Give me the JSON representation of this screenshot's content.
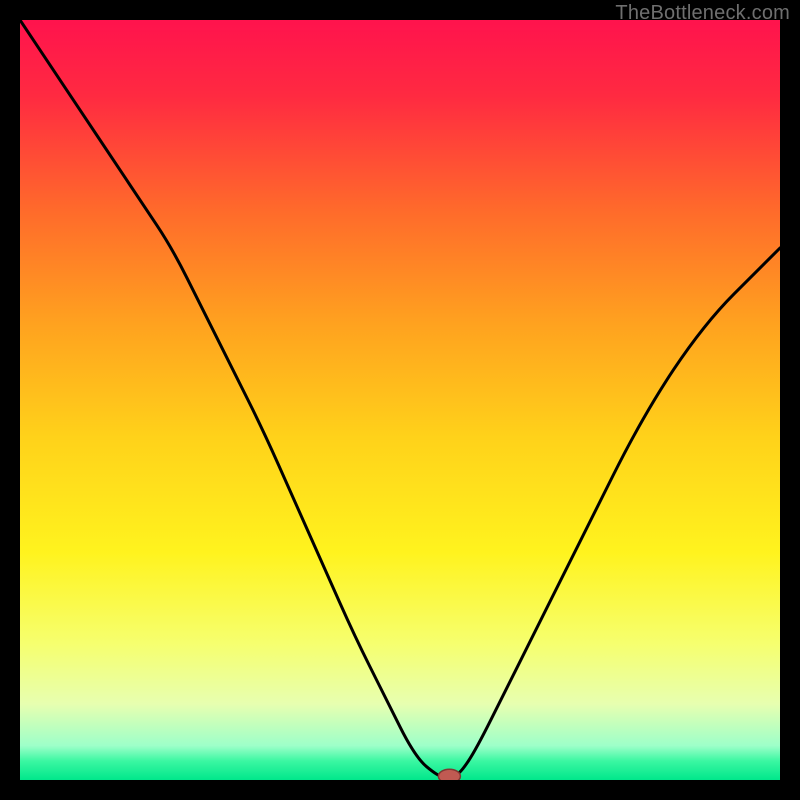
{
  "attribution": "TheBottleneck.com",
  "colors": {
    "frame": "#000000",
    "gradient_stops": [
      {
        "offset": 0.0,
        "color": "#ff134d"
      },
      {
        "offset": 0.1,
        "color": "#ff2a41"
      },
      {
        "offset": 0.25,
        "color": "#ff6a2b"
      },
      {
        "offset": 0.4,
        "color": "#ffa21f"
      },
      {
        "offset": 0.55,
        "color": "#ffd21a"
      },
      {
        "offset": 0.7,
        "color": "#fff31e"
      },
      {
        "offset": 0.82,
        "color": "#f6ff6e"
      },
      {
        "offset": 0.9,
        "color": "#e7ffb0"
      },
      {
        "offset": 0.955,
        "color": "#9dffc9"
      },
      {
        "offset": 0.975,
        "color": "#3bf7a2"
      },
      {
        "offset": 1.0,
        "color": "#00e78b"
      }
    ],
    "curve": "#000000",
    "marker_fill": "#c05a52",
    "marker_stroke": "#803833"
  },
  "chart_data": {
    "type": "line",
    "title": "",
    "xlabel": "",
    "ylabel": "",
    "xlim": [
      0,
      100
    ],
    "ylim": [
      0,
      100
    ],
    "grid": false,
    "legend": false,
    "x": [
      0,
      4,
      8,
      12,
      16,
      20,
      24,
      28,
      32,
      36,
      40,
      44,
      48,
      52,
      55,
      56,
      57,
      58,
      60,
      64,
      68,
      72,
      76,
      80,
      84,
      88,
      92,
      96,
      100
    ],
    "values": [
      100,
      94,
      88,
      82,
      76,
      70,
      62,
      54,
      46,
      37,
      28,
      19,
      11,
      3,
      0.5,
      0.5,
      0.5,
      1,
      4,
      12,
      20,
      28,
      36,
      44,
      51,
      57,
      62,
      66,
      70
    ],
    "marker": {
      "x": 56.5,
      "y": 0.5
    },
    "notes": "y-axis inverted visually (0 at bottom = green, 100 at top = red). Curve is a V-shaped bottleneck dip with minimum near x≈56."
  }
}
